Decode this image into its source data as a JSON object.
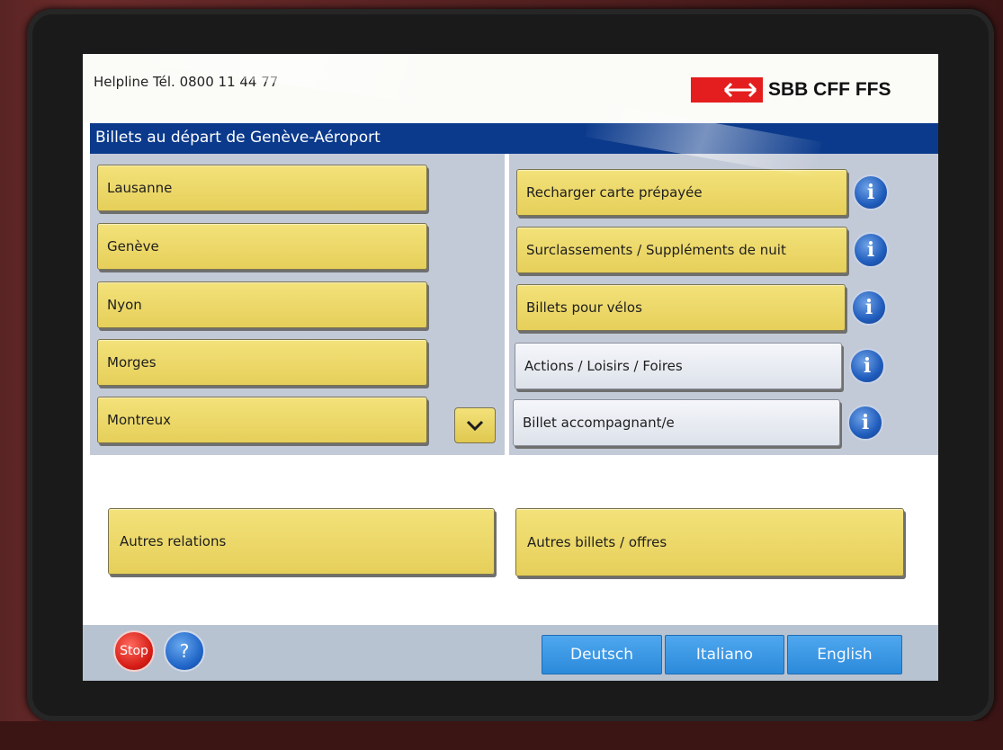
{
  "helpline": "Helpline  Tél. 0800 11 44 77",
  "logo": {
    "text": "SBB CFF FFS",
    "icon": "double-arrow-icon",
    "brand_red": "#e41e1e"
  },
  "title": "Billets au départ de Genève-Aéroport",
  "destinations": [
    "Lausanne",
    "Genève",
    "Nyon",
    "Morges",
    "Montreux"
  ],
  "scroll_icon": "chevron-down-icon",
  "services": [
    {
      "label": "Recharger carte prépayée",
      "style": "yellow"
    },
    {
      "label": "Surclassements / Suppléments de nuit",
      "style": "yellow"
    },
    {
      "label": "Billets pour vélos",
      "style": "yellow"
    },
    {
      "label": "Actions / Loisirs / Foires",
      "style": "white"
    },
    {
      "label": "Billet accompagnant/e",
      "style": "white"
    }
  ],
  "info_label": "i",
  "other_relations": "Autres relations",
  "other_tickets": "Autres billets / offres",
  "stop_label": "Stop",
  "help_label": "?",
  "languages": [
    "Deutsch",
    "Italiano",
    "English"
  ],
  "colors": {
    "title_bar": "#0b3a8c",
    "button_yellow": "#ecd768",
    "language_blue": "#3a97e4"
  }
}
